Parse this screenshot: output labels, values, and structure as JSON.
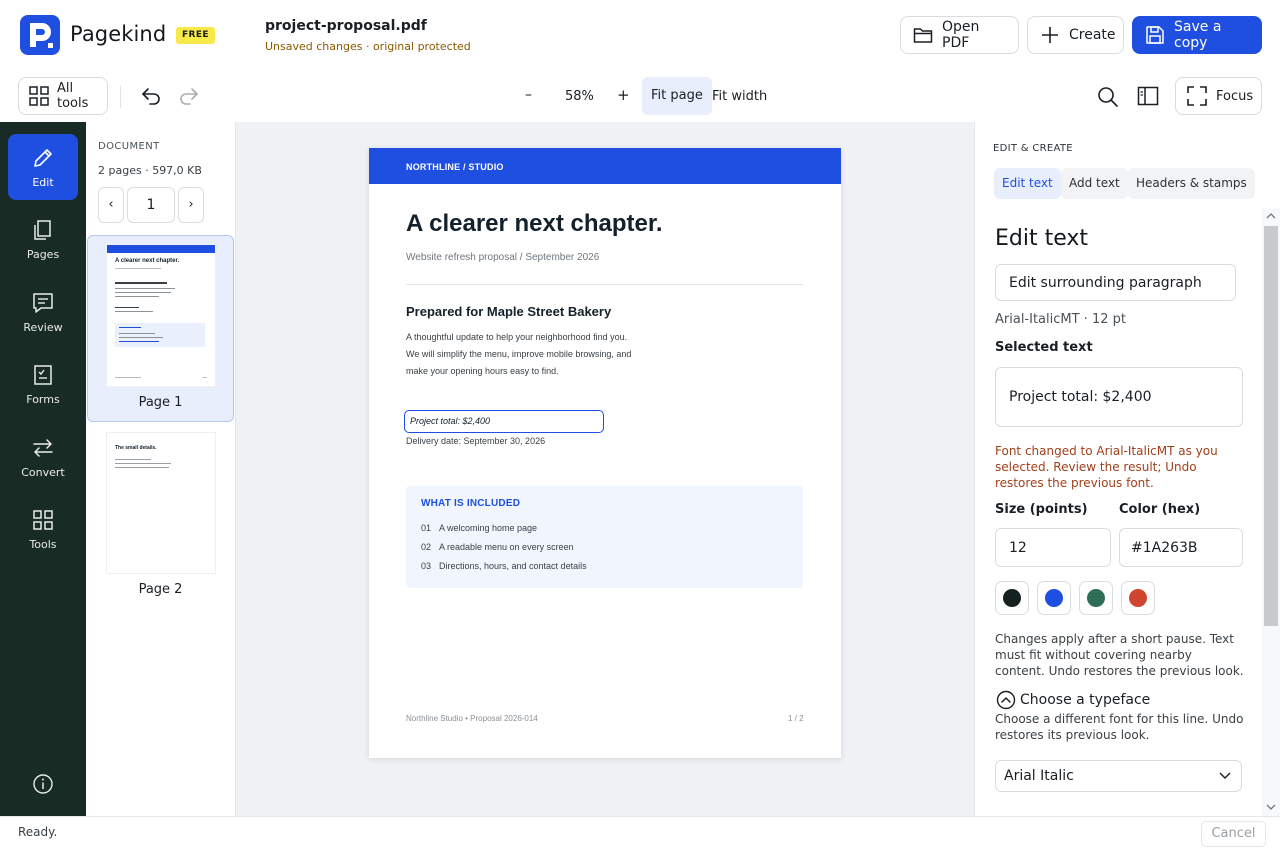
{
  "app": {
    "name": "Pagekind",
    "plan_badge": "FREE"
  },
  "file": {
    "name": "project-proposal.pdf",
    "status": "Unsaved changes · original protected"
  },
  "header_actions": {
    "open": "Open PDF",
    "create": "Create",
    "save": "Save a copy"
  },
  "toolbar": {
    "all_tools": "All tools",
    "zoom_out": "–",
    "zoom": "58%",
    "zoom_in": "+",
    "fit_page": "Fit page",
    "fit_width": "Fit width",
    "focus": "Focus"
  },
  "rail": [
    {
      "label": "Edit",
      "icon": "pencil-icon"
    },
    {
      "label": "Pages",
      "icon": "pages-icon"
    },
    {
      "label": "Review",
      "icon": "comment-icon"
    },
    {
      "label": "Forms",
      "icon": "form-icon"
    },
    {
      "label": "Convert",
      "icon": "convert-icon"
    },
    {
      "label": "Tools",
      "icon": "grid-icon"
    }
  ],
  "thumbnails": {
    "section_label": "DOCUMENT",
    "meta": "2 pages · 597,0 KB",
    "prev": "‹",
    "next": "›",
    "current_page": "1",
    "pages": [
      {
        "label": "Page 1"
      },
      {
        "label": "Page 2"
      }
    ],
    "page2_preview_title": "The small details."
  },
  "document": {
    "band_text": "NORTHLINE / STUDIO",
    "title": "A clearer next chapter.",
    "subtitle": "Website refresh proposal  /  September 2026",
    "heading": "Prepared for Maple Street Bakery",
    "body": [
      "A thoughtful update to help your neighborhood find you.",
      "We will simplify the menu, improve mobile browsing, and",
      "make your opening hours easy to find."
    ],
    "selected_line": "Project total: $2,400",
    "delivery": "Delivery date: September 30, 2026",
    "included_title": "WHAT IS INCLUDED",
    "included": [
      {
        "num": "01",
        "text": "A welcoming home page"
      },
      {
        "num": "02",
        "text": "A readable menu on every screen"
      },
      {
        "num": "03",
        "text": "Directions, hours, and contact details"
      }
    ],
    "footer_left": "Northline Studio  •  Proposal 2026-014",
    "footer_right": "1 / 2"
  },
  "panel": {
    "section_label": "EDIT & CREATE",
    "tabs": [
      "Edit text",
      "Add text",
      "Headers & stamps"
    ],
    "heading": "Edit text",
    "mode_button": "Edit surrounding paragraph",
    "font_info": "Arial-ItalicMT · 12 pt",
    "selected_label": "Selected text",
    "selected_value": "Project total: $2,400",
    "warning": "Font changed to Arial-ItalicMT as you selected. Review the result; Undo restores the previous font.",
    "size_label": "Size (points)",
    "size_value": "12",
    "color_label": "Color (hex)",
    "color_value": "#1A263B",
    "swatches": [
      "#15211f",
      "#1f4fe0",
      "#2e6e56",
      "#d0452d"
    ],
    "note": "Changes apply after a short pause. Text must fit without covering nearby content. Undo restores the previous look.",
    "typeface_toggle": "Choose a typeface",
    "typeface_help": "Choose a different font for this line. Undo restores its previous look.",
    "typeface_value": "Arial Italic"
  },
  "statusbar": {
    "text": "Ready.",
    "cancel": "Cancel"
  }
}
